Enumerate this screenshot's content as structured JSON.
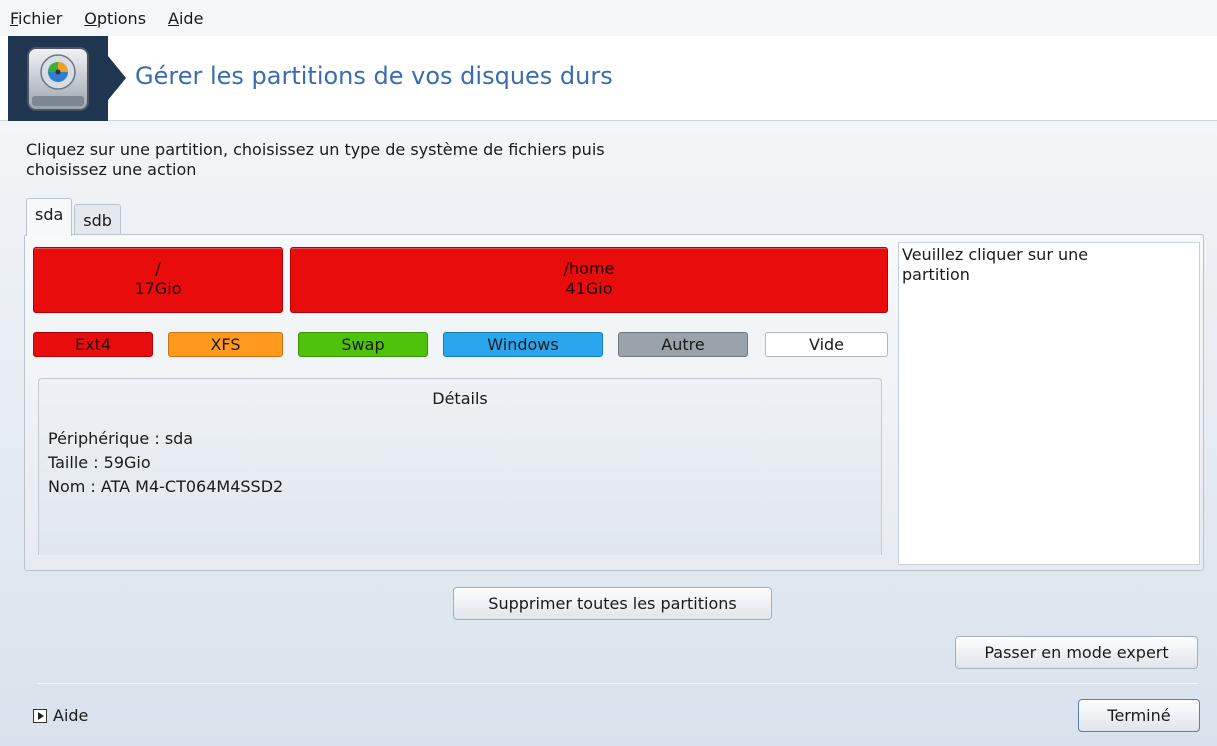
{
  "menu": {
    "items": [
      {
        "accel": "F",
        "rest": "ichier"
      },
      {
        "accel": "O",
        "rest": "ptions"
      },
      {
        "accel": "A",
        "rest": "ide"
      }
    ]
  },
  "header": {
    "icon": "hard-disk-icon",
    "title": "Gérer les partitions de vos disques durs"
  },
  "instructions": {
    "line1": "Cliquez sur une partition, choisissez un type de système de fichiers puis",
    "line2": "choisissez une action"
  },
  "tabs": [
    {
      "label": "sda",
      "active": true
    },
    {
      "label": "sdb",
      "active": false
    }
  ],
  "partitions": [
    {
      "mount": "/",
      "size": "17Gio",
      "color": "#e80c0c"
    },
    {
      "mount": "/home",
      "size": "41Gio",
      "color": "#e80c0c"
    }
  ],
  "legend": [
    {
      "label": "Ext4",
      "color": "#e80c0c"
    },
    {
      "label": "XFS",
      "color": "#ff9a1f"
    },
    {
      "label": "Swap",
      "color": "#4fc30b"
    },
    {
      "label": "Windows",
      "color": "#2aa6ef"
    },
    {
      "label": "Autre",
      "color": "#9aa2ab"
    },
    {
      "label": "Vide",
      "color": "#ffffff"
    }
  ],
  "details": {
    "title": "Détails",
    "lines": [
      "Périphérique : sda",
      "Taille : 59Gio",
      "Nom : ATA M4-CT064M4SSD2"
    ]
  },
  "info_panel": {
    "text_line1": "Veuillez cliquer sur une",
    "text_line2": "partition"
  },
  "buttons": {
    "delete_all": "Supprimer toutes les partitions",
    "expert_mode": "Passer en mode expert",
    "done": "Terminé"
  },
  "footer": {
    "help_label": "Aide"
  }
}
